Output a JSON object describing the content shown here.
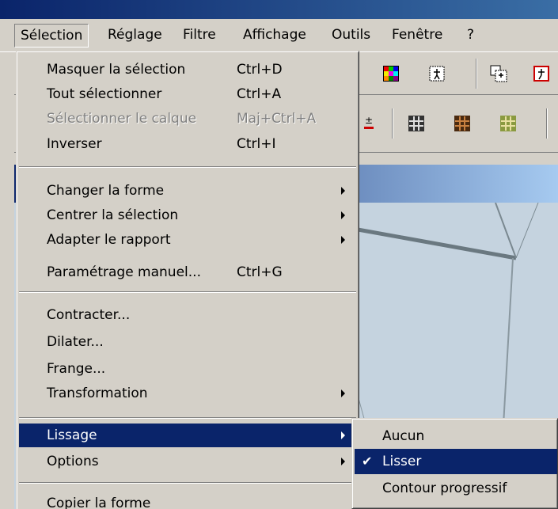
{
  "menubar": {
    "items": [
      {
        "label": "Sélection",
        "active": true
      },
      {
        "label": "Réglage"
      },
      {
        "label": "Filtre"
      },
      {
        "label": "Affichage"
      },
      {
        "label": "Outils"
      },
      {
        "label": "Fenêtre"
      },
      {
        "label": "?"
      }
    ]
  },
  "menu": {
    "items": [
      {
        "label": "Masquer la sélection",
        "shortcut": "Ctrl+D"
      },
      {
        "label": "Tout sélectionner",
        "shortcut": "Ctrl+A"
      },
      {
        "label": "Sélectionner le calque",
        "shortcut": "Maj+Ctrl+A",
        "disabled": true
      },
      {
        "label": "Inverser",
        "shortcut": "Ctrl+I"
      },
      {
        "label": "Changer la forme",
        "submenu": true
      },
      {
        "label": "Centrer la sélection",
        "submenu": true
      },
      {
        "label": "Adapter le rapport",
        "submenu": true
      },
      {
        "label": "Paramétrage manuel...",
        "shortcut": "Ctrl+G"
      },
      {
        "label": "Contracter..."
      },
      {
        "label": "Dilater..."
      },
      {
        "label": "Frange..."
      },
      {
        "label": "Transformation",
        "submenu": true
      },
      {
        "label": "Lissage",
        "submenu": true,
        "highlighted": true
      },
      {
        "label": "Options",
        "submenu": true
      },
      {
        "label": "Copier la forme"
      }
    ]
  },
  "submenu": {
    "items": [
      {
        "label": "Aucun"
      },
      {
        "label": "Lisser",
        "checked": true,
        "highlighted": true
      },
      {
        "label": "Contour progressif"
      }
    ],
    "check_glyph": "✔"
  },
  "toolbar": {
    "icons": [
      "palette-icon",
      "select-figure-icon",
      "select-figure-icon-2",
      "select-figure-icon-3",
      "plus-minus-icon",
      "grid-icon",
      "grid-brown-icon",
      "grid-green-icon"
    ],
    "plus_minus_text": "±"
  },
  "colors": {
    "menu_bg": "#d4d0c8",
    "highlight": "#0a246a",
    "title_gradient_start": "#0a246a",
    "canvas_bg": "#c5d3df"
  }
}
